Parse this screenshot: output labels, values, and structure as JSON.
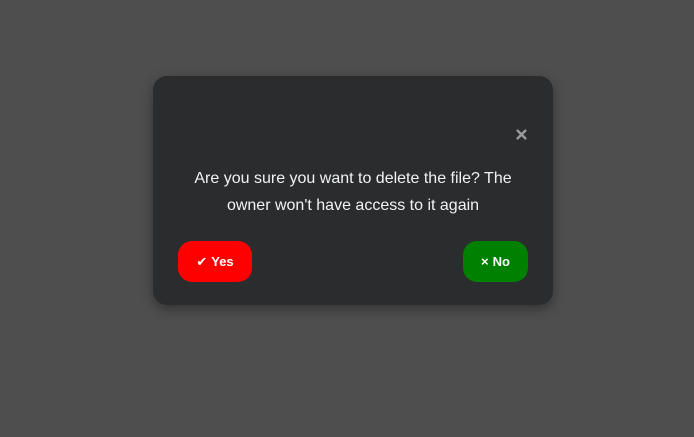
{
  "dialog": {
    "message": "Are you sure you want to delete the file? The owner won't have access to it again",
    "close_icon": "close-icon",
    "yes_button": {
      "icon": "✔",
      "label": "Yes",
      "color": "#ff0000"
    },
    "no_button": {
      "icon": "×",
      "label": "No",
      "color": "#008000"
    }
  },
  "colors": {
    "backdrop": "#4e4e4e",
    "dialog_bg": "#2b2c2e",
    "text": "#f2f2f2",
    "close_icon": "#9a9a9a"
  }
}
